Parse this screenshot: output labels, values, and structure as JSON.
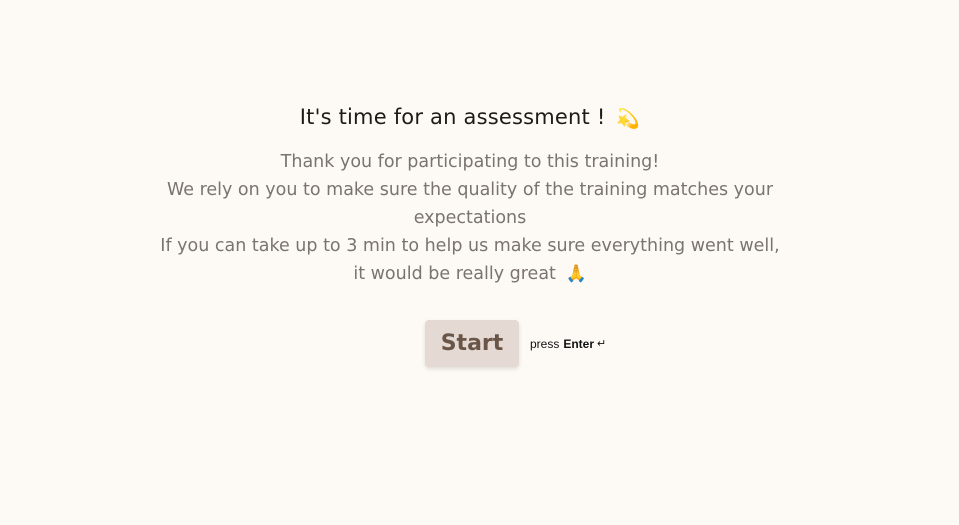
{
  "intro": {
    "title": "It's time for an assessment !",
    "title_emoji": "💫",
    "lines": [
      "Thank you for participating to this training!",
      "We rely on you to make sure the quality of the training matches your expectations",
      "If you can take up to 3 min to help us make sure everything went well,",
      "it would be really great"
    ],
    "closing_emoji": "🙏"
  },
  "actions": {
    "start_label": "Start",
    "hint_prefix": "press",
    "hint_key": "Enter",
    "hint_icon": "↵"
  },
  "colors": {
    "background": "#fdfaf5",
    "button_bg": "#e4d9d3",
    "button_text": "#6a5648",
    "body_text": "#7b7370"
  }
}
